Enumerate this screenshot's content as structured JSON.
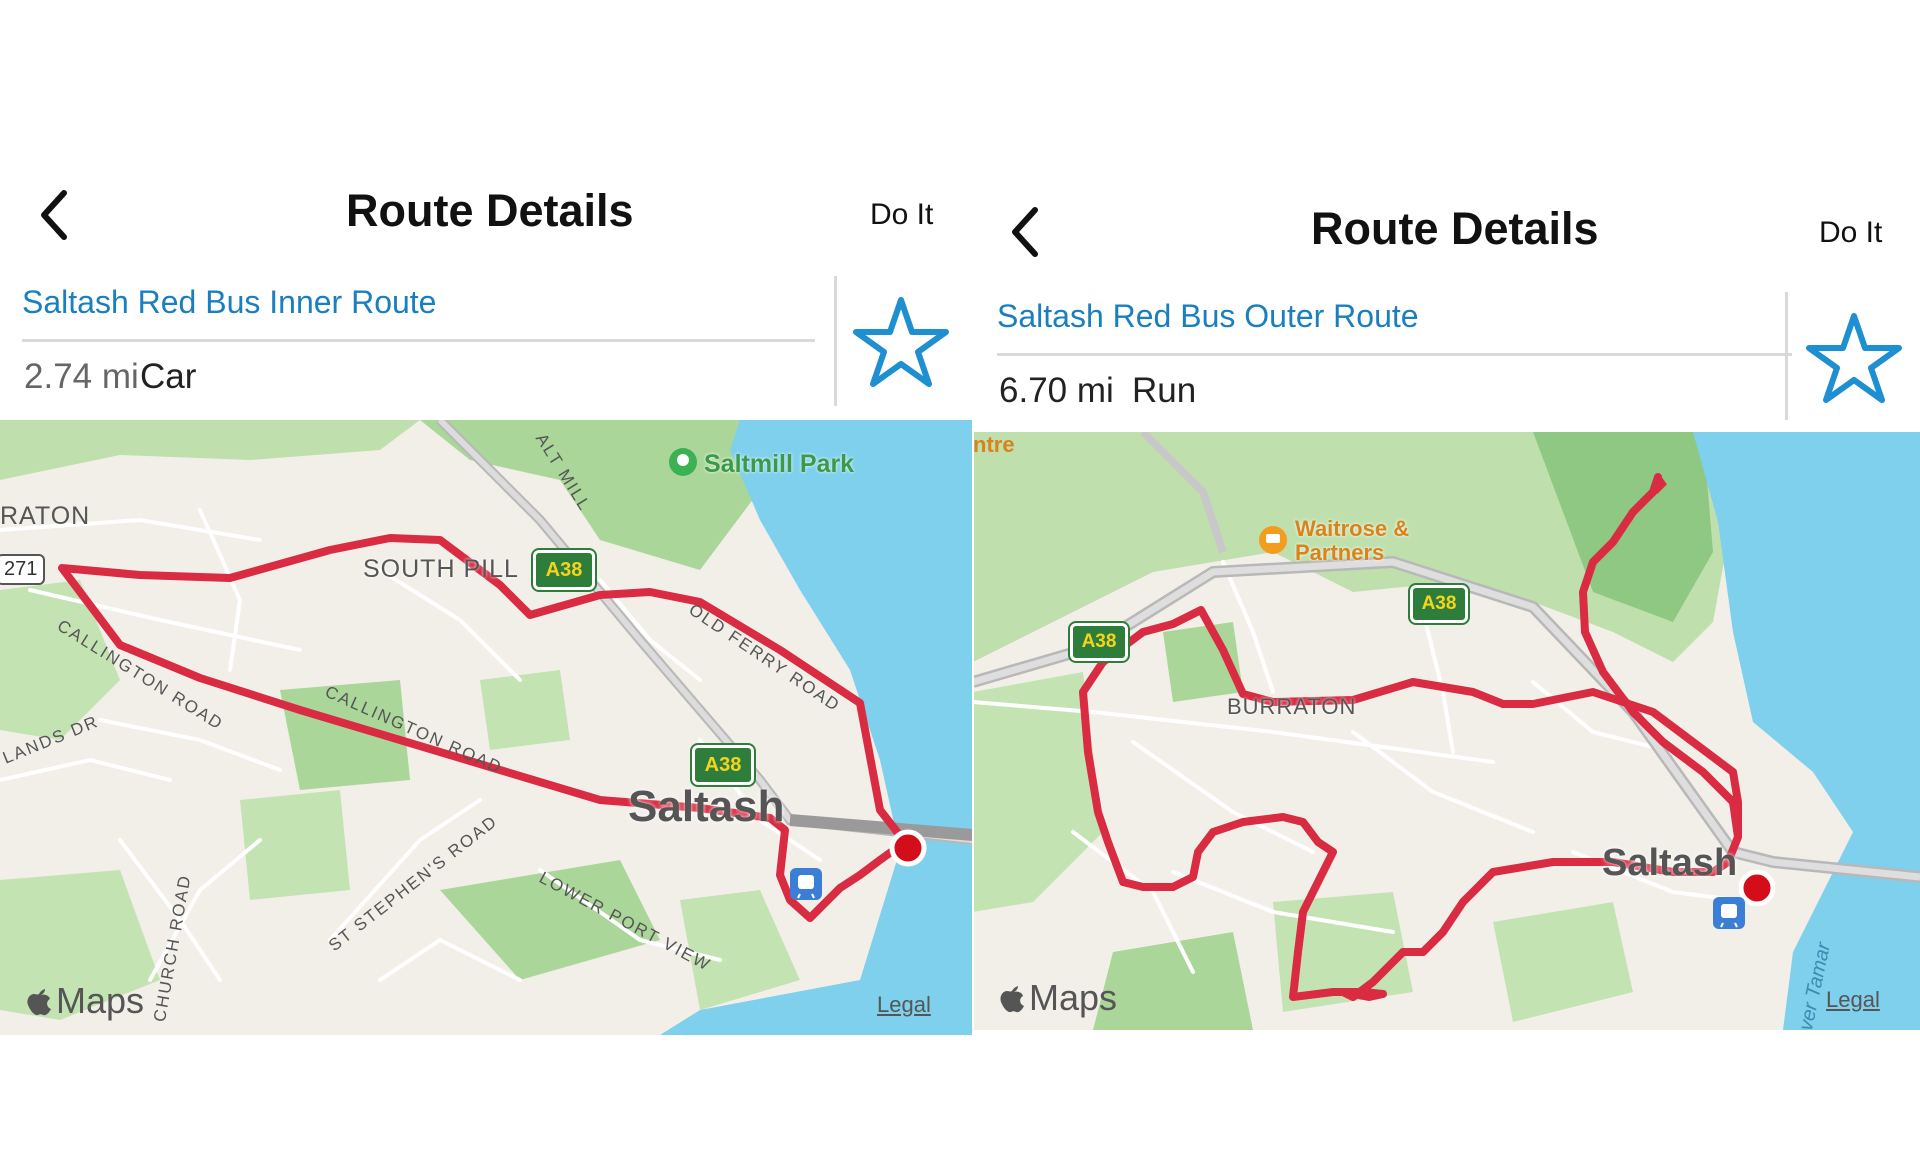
{
  "left": {
    "nav": {
      "title": "Route Details",
      "action": "Do It"
    },
    "route": {
      "name": "Saltash Red Bus Inner Route",
      "distance": "2.74 mi",
      "mode": "Car"
    },
    "map": {
      "place_labels": {
        "town": "Saltash",
        "south_pill": "SOUTH PILL",
        "raton": "RATON",
        "park": "Saltmill Park",
        "callington_road_1": "CALLINGTON ROAD",
        "callington_road_2": "CALLINGTON ROAD",
        "old_ferry_road": "OLD FERRY ROAD",
        "st_stephens_road": "ST STEPHEN'S ROAD",
        "lower_port_view": "LOWER PORT VIEW",
        "church_road": "CHURCH ROAD",
        "lands_dr": "LANDS DR",
        "alt_mill": "ALT MILL",
        "road_shield_271": "271"
      },
      "road_shields": [
        "A38",
        "A38"
      ],
      "brand": "Maps",
      "legal": "Legal"
    }
  },
  "right": {
    "nav": {
      "title": "Route Details",
      "action": "Do It"
    },
    "route": {
      "name": "Saltash Red Bus Outer Route",
      "distance": "6.70 mi",
      "mode": "Run"
    },
    "map": {
      "place_labels": {
        "town": "Saltash",
        "burraton": "BURRATON",
        "waitrose_1": "Waitrose &",
        "waitrose_2": "Partners",
        "river": "ver Tamar",
        "ntre": "ntre"
      },
      "road_shields": [
        "A38",
        "A38"
      ],
      "brand": "Maps",
      "legal": "Legal"
    }
  },
  "colors": {
    "route_line": "#d92b42",
    "link_blue": "#1a7fbf",
    "water": "#7fd0ec",
    "park_green": "#aad69a",
    "land": "#f2efe9",
    "shield_green": "#2f7d3a",
    "shield_text": "#f4d51c"
  }
}
